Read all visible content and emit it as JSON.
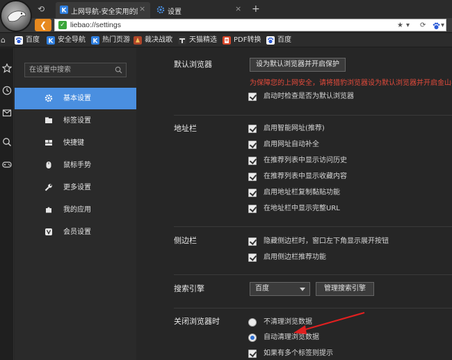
{
  "browser": {
    "tabs": [
      {
        "title": "上网导航-安全实用的网",
        "close": "×"
      },
      {
        "title": "设置",
        "close": "×"
      }
    ],
    "new_tab": "+",
    "back_glyph": "⟲",
    "url": "liebao://settings",
    "url_tools": {
      "star": "★",
      "dropdown": "▾",
      "refresh": "⟳",
      "search_dropdown": "▾"
    }
  },
  "bookmarks": [
    {
      "label": "百度",
      "icon": "baidu-paw-icon",
      "color": "#2b5bd7"
    },
    {
      "label": "安全导航",
      "icon": "k-shield-icon",
      "color": "#2f7fe0"
    },
    {
      "label": "热门页游",
      "icon": "k-shield-icon",
      "color": "#2f7fe0"
    },
    {
      "label": "裁决战歌",
      "icon": "game-icon",
      "color": "#b0462a"
    },
    {
      "label": "天猫精选",
      "icon": "tmall-icon",
      "color": "#333333"
    },
    {
      "label": "PDF转换",
      "icon": "pdf-icon",
      "color": "#d9482b"
    },
    {
      "label": "百度",
      "icon": "baidu-paw-icon",
      "color": "#2b5bd7"
    }
  ],
  "settings_nav": {
    "search_placeholder": "在设置中搜索",
    "items": [
      {
        "label": "基本设置",
        "icon": "gear-icon",
        "active": true
      },
      {
        "label": "标签设置",
        "icon": "tab-icon",
        "active": false
      },
      {
        "label": "快捷键",
        "icon": "keyboard-icon",
        "active": false
      },
      {
        "label": "鼠标手势",
        "icon": "mouse-icon",
        "active": false
      },
      {
        "label": "更多设置",
        "icon": "wrench-icon",
        "active": false
      },
      {
        "label": "我的应用",
        "icon": "puzzle-icon",
        "active": false
      },
      {
        "label": "会员设置",
        "icon": "vip-icon",
        "active": false
      }
    ]
  },
  "sections": {
    "default_browser": {
      "title": "默认浏览器",
      "button": "设为默认浏览器并开启保护",
      "warning": "为保障您的上网安全，请将猎豹浏览器设为默认浏览器并开启金山毒霸",
      "options": [
        {
          "label": "启动时检查是否为默认浏览器",
          "checked": true
        }
      ]
    },
    "address_bar": {
      "title": "地址栏",
      "options": [
        {
          "label": "启用智能网址(推荐)",
          "checked": true
        },
        {
          "label": "启用网址自动补全",
          "checked": true
        },
        {
          "label": "在推荐列表中显示访问历史",
          "checked": true
        },
        {
          "label": "在推荐列表中显示收藏内容",
          "checked": true
        },
        {
          "label": "启用地址栏复制黏贴功能",
          "checked": true
        },
        {
          "label": "在地址栏中显示完整URL",
          "checked": true
        }
      ]
    },
    "sidebar": {
      "title": "侧边栏",
      "options": [
        {
          "label": "隐藏侧边栏时，窗口左下角显示展开按钮",
          "checked": true
        },
        {
          "label": "启用侧边栏推荐功能",
          "checked": true
        }
      ]
    },
    "search_engine": {
      "title": "搜索引擎",
      "selected": "百度",
      "manage_button": "管理搜索引擎"
    },
    "on_close": {
      "title": "关闭浏览器时",
      "radios": [
        {
          "label": "不清理浏览数据",
          "selected": false
        },
        {
          "label": "自动清理浏览数据",
          "selected": true
        }
      ],
      "options": [
        {
          "label": "如果有多个标签则提示",
          "checked": true
        }
      ]
    }
  },
  "colors": {
    "accent": "#4a8fe0",
    "warning": "#e24a3b",
    "arrow": "#e02020",
    "back_button": "#e7891f"
  }
}
